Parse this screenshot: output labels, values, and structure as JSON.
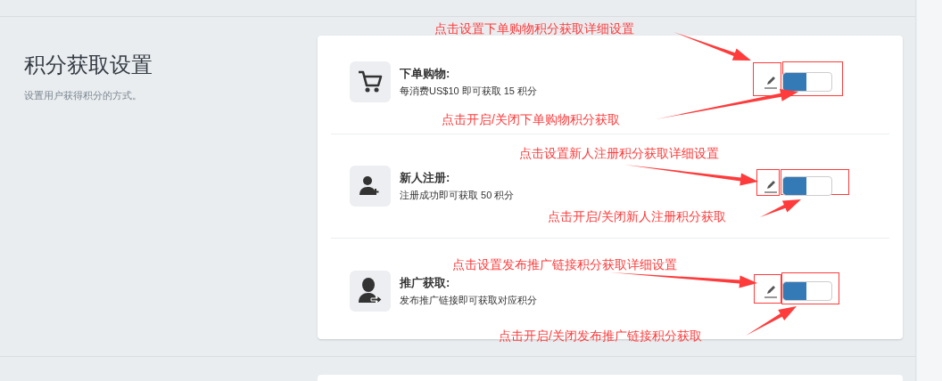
{
  "section": {
    "title": "积分获取设置",
    "description": "设置用户获得积分的方式。"
  },
  "items": [
    {
      "kind": "cart",
      "title": "下单购物:",
      "description": "每消费US$10 即可获取 15 积分",
      "on": true
    },
    {
      "kind": "user-add",
      "title": "新人注册:",
      "description": "注册成功即可获取 50 积分",
      "on": true
    },
    {
      "kind": "user-share",
      "title": "推广获取:",
      "description": "发布推广链接即可获取对应积分",
      "on": true
    }
  ],
  "annotations": [
    {
      "text": "点击设置下单购物积分获取详细设置"
    },
    {
      "text": "点击开启/关闭下单购物积分获取"
    },
    {
      "text": "点击设置新人注册积分获取详细设置"
    },
    {
      "text": "点击开启/关闭新人注册积分获取"
    },
    {
      "text": "点击设置发布推广链接积分获取详细设置"
    },
    {
      "text": "点击开启/关闭发布推广链接积分获取"
    }
  ]
}
